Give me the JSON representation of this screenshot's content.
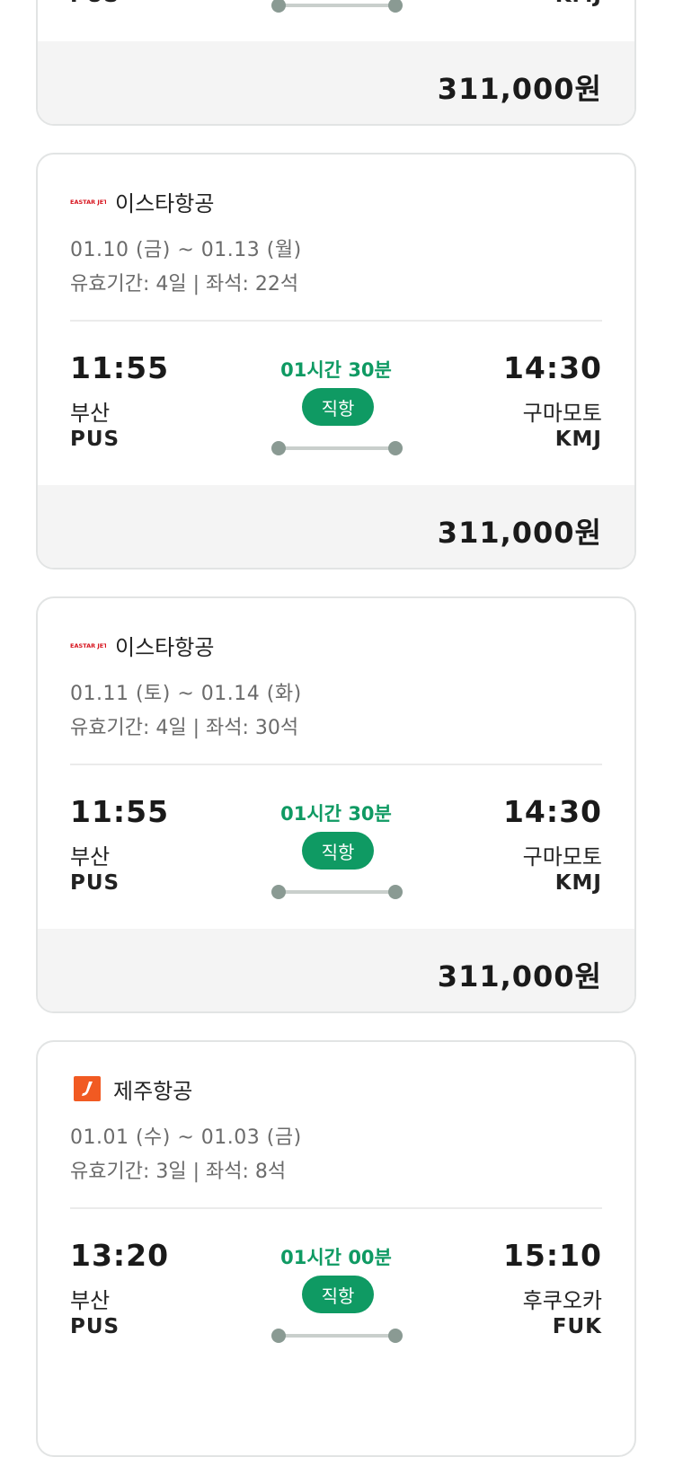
{
  "cards": [
    {
      "dep_time": "",
      "arr_time": "",
      "dep_city": "",
      "arr_city": "",
      "dep_code": "PUS",
      "arr_code": "KMJ",
      "duration": "",
      "badge": "",
      "price": "311,000원"
    },
    {
      "airline": "이스타항공",
      "logo": "eastar-jet-logo-icon",
      "logo_text": "EASTAR JET",
      "dates": "01.10 (금) ~ 01.13 (월)",
      "validity": "유효기간: 4일 | 좌석: 22석",
      "dep_time": "11:55",
      "arr_time": "14:30",
      "dep_city": "부산",
      "arr_city": "구마모토",
      "dep_code": "PUS",
      "arr_code": "KMJ",
      "duration": "01시간 30분",
      "badge": "직항",
      "price": "311,000원"
    },
    {
      "airline": "이스타항공",
      "logo": "eastar-jet-logo-icon",
      "logo_text": "EASTAR JET",
      "dates": "01.11 (토) ~ 01.14 (화)",
      "validity": "유효기간: 4일 | 좌석: 30석",
      "dep_time": "11:55",
      "arr_time": "14:30",
      "dep_city": "부산",
      "arr_city": "구마모토",
      "dep_code": "PUS",
      "arr_code": "KMJ",
      "duration": "01시간 30분",
      "badge": "직항",
      "price": "311,000원"
    },
    {
      "airline": "제주항공",
      "logo": "jeju-air-logo-icon",
      "dates": "01.01 (수) ~ 01.03 (금)",
      "validity": "유효기간: 3일 | 좌석: 8석",
      "dep_time": "13:20",
      "arr_time": "15:10",
      "dep_city": "부산",
      "arr_city": "후쿠오카",
      "dep_code": "PUS",
      "arr_code": "FUK",
      "duration": "01시간 00분",
      "badge": "직항"
    }
  ],
  "colors": {
    "accent_green": "#0f9a63",
    "eastar_red": "#d7141e",
    "jeju_orange": "#f15a22",
    "price_bg": "#f4f4f4"
  }
}
